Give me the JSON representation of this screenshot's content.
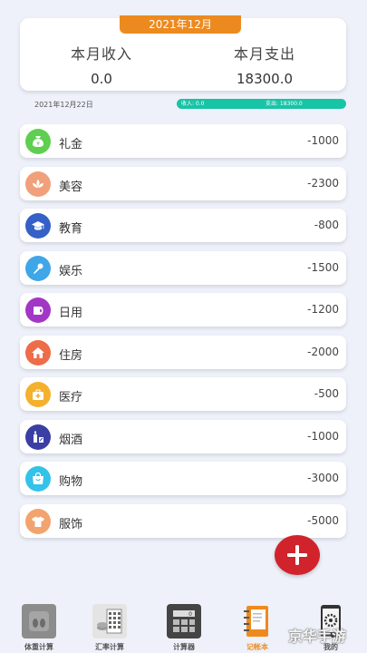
{
  "summary": {
    "month": "2021年12月",
    "income_label": "本月收入",
    "income_value": "0.0",
    "expense_label": "本月支出",
    "expense_value": "18300.0"
  },
  "date_row": {
    "date": "2021年12月22日",
    "income_text": "收入: 0.0",
    "expense_text": "支出: 18300.0"
  },
  "records": [
    {
      "name": "礼金",
      "amount": "-1000",
      "icon": "money-bag-icon",
      "color": "#5ecf4f"
    },
    {
      "name": "美容",
      "amount": "-2300",
      "icon": "lotus-icon",
      "color": "#f0a07b"
    },
    {
      "name": "教育",
      "amount": "-800",
      "icon": "graduation-cap-icon",
      "color": "#3460c7"
    },
    {
      "name": "娱乐",
      "amount": "-1500",
      "icon": "microphone-icon",
      "color": "#3fa6e8"
    },
    {
      "name": "日用",
      "amount": "-1200",
      "icon": "toilet-paper-icon",
      "color": "#a237c5"
    },
    {
      "name": "住房",
      "amount": "-2000",
      "icon": "house-icon",
      "color": "#ef6c48"
    },
    {
      "name": "医疗",
      "amount": "-500",
      "icon": "medical-kit-icon",
      "color": "#f3b12e"
    },
    {
      "name": "烟酒",
      "amount": "-1000",
      "icon": "bottle-icon",
      "color": "#3b3fa3"
    },
    {
      "name": "购物",
      "amount": "-3000",
      "icon": "shopping-bag-icon",
      "color": "#33c2ea"
    },
    {
      "name": "服饰",
      "amount": "-5000",
      "icon": "shirt-icon",
      "color": "#f3a36e"
    }
  ],
  "tabs": [
    {
      "label": "体重计算",
      "icon": "scale-icon"
    },
    {
      "label": "汇率计算",
      "icon": "calculator-coins-icon"
    },
    {
      "label": "计算器",
      "icon": "calculator-icon"
    },
    {
      "label": "记帐本",
      "icon": "notebook-icon"
    },
    {
      "label": "我的",
      "icon": "phone-settings-icon"
    }
  ],
  "watermark": "京华手游"
}
